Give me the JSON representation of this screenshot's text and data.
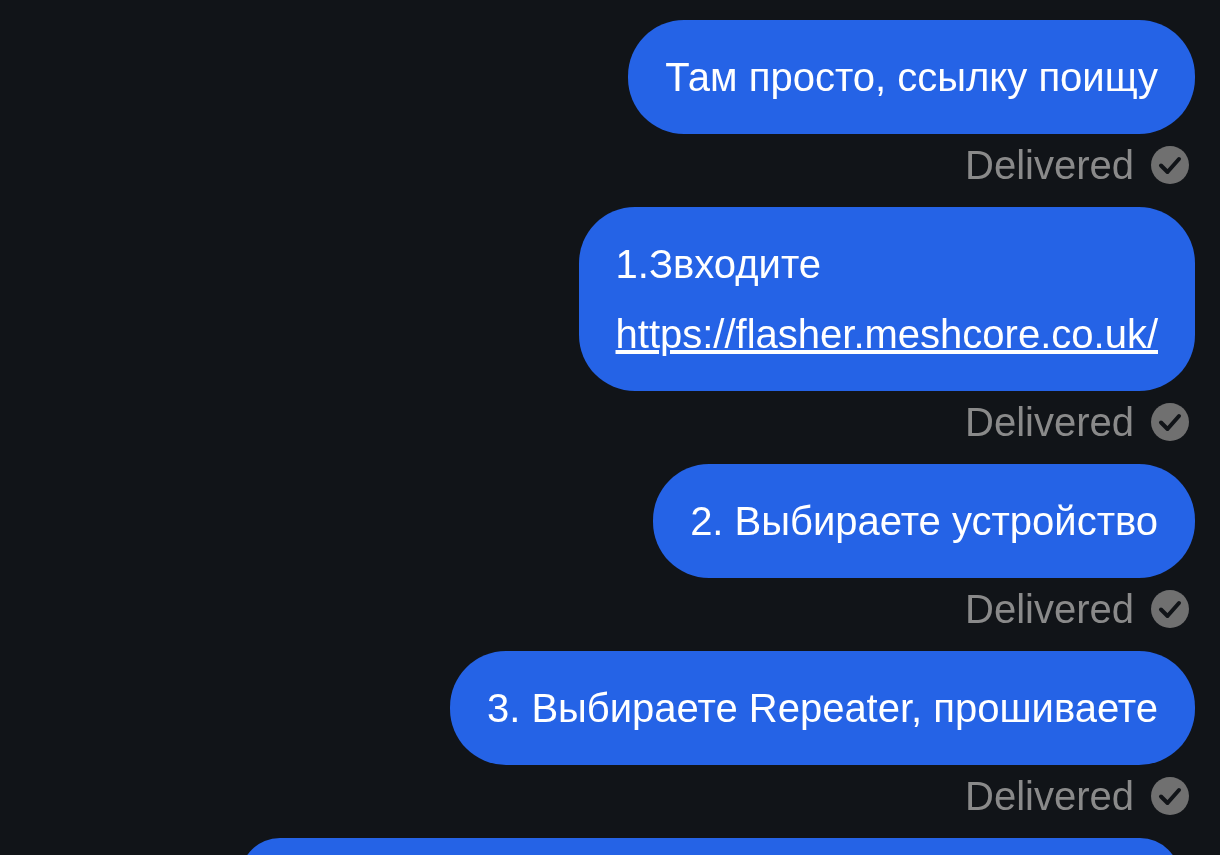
{
  "messages": [
    {
      "lines": [
        {
          "kind": "text",
          "text": "Там просто, ссылку поищу"
        }
      ],
      "status": {
        "text": "Delivered"
      }
    },
    {
      "lines": [
        {
          "kind": "text",
          "text": "1.Звходите"
        },
        {
          "kind": "link",
          "text": "https://flasher.meshcore.co.uk/"
        }
      ],
      "status": {
        "text": "Delivered"
      }
    },
    {
      "lines": [
        {
          "kind": "text",
          "text": "2. Выбираете устройство"
        }
      ],
      "status": {
        "text": "Delivered"
      }
    },
    {
      "lines": [
        {
          "kind": "text",
          "text": "3. Выбираете Repeater, прошиваете"
        }
      ],
      "status": {
        "text": "Delivered"
      }
    },
    {
      "cut_off": true
    }
  ]
}
